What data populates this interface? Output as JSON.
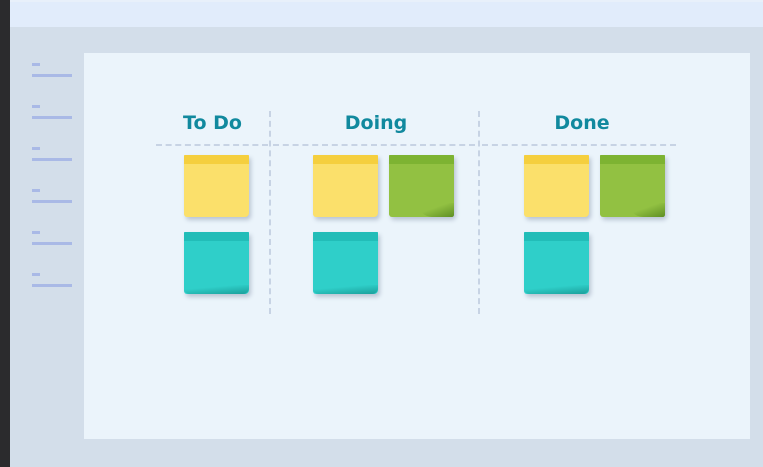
{
  "board": {
    "columns": [
      {
        "title": "To Do"
      },
      {
        "title": "Doing"
      },
      {
        "title": "Done"
      }
    ],
    "note_colors": {
      "yellow": "#fbe06b",
      "green": "#92c142",
      "teal": "#2fcfc9"
    }
  }
}
